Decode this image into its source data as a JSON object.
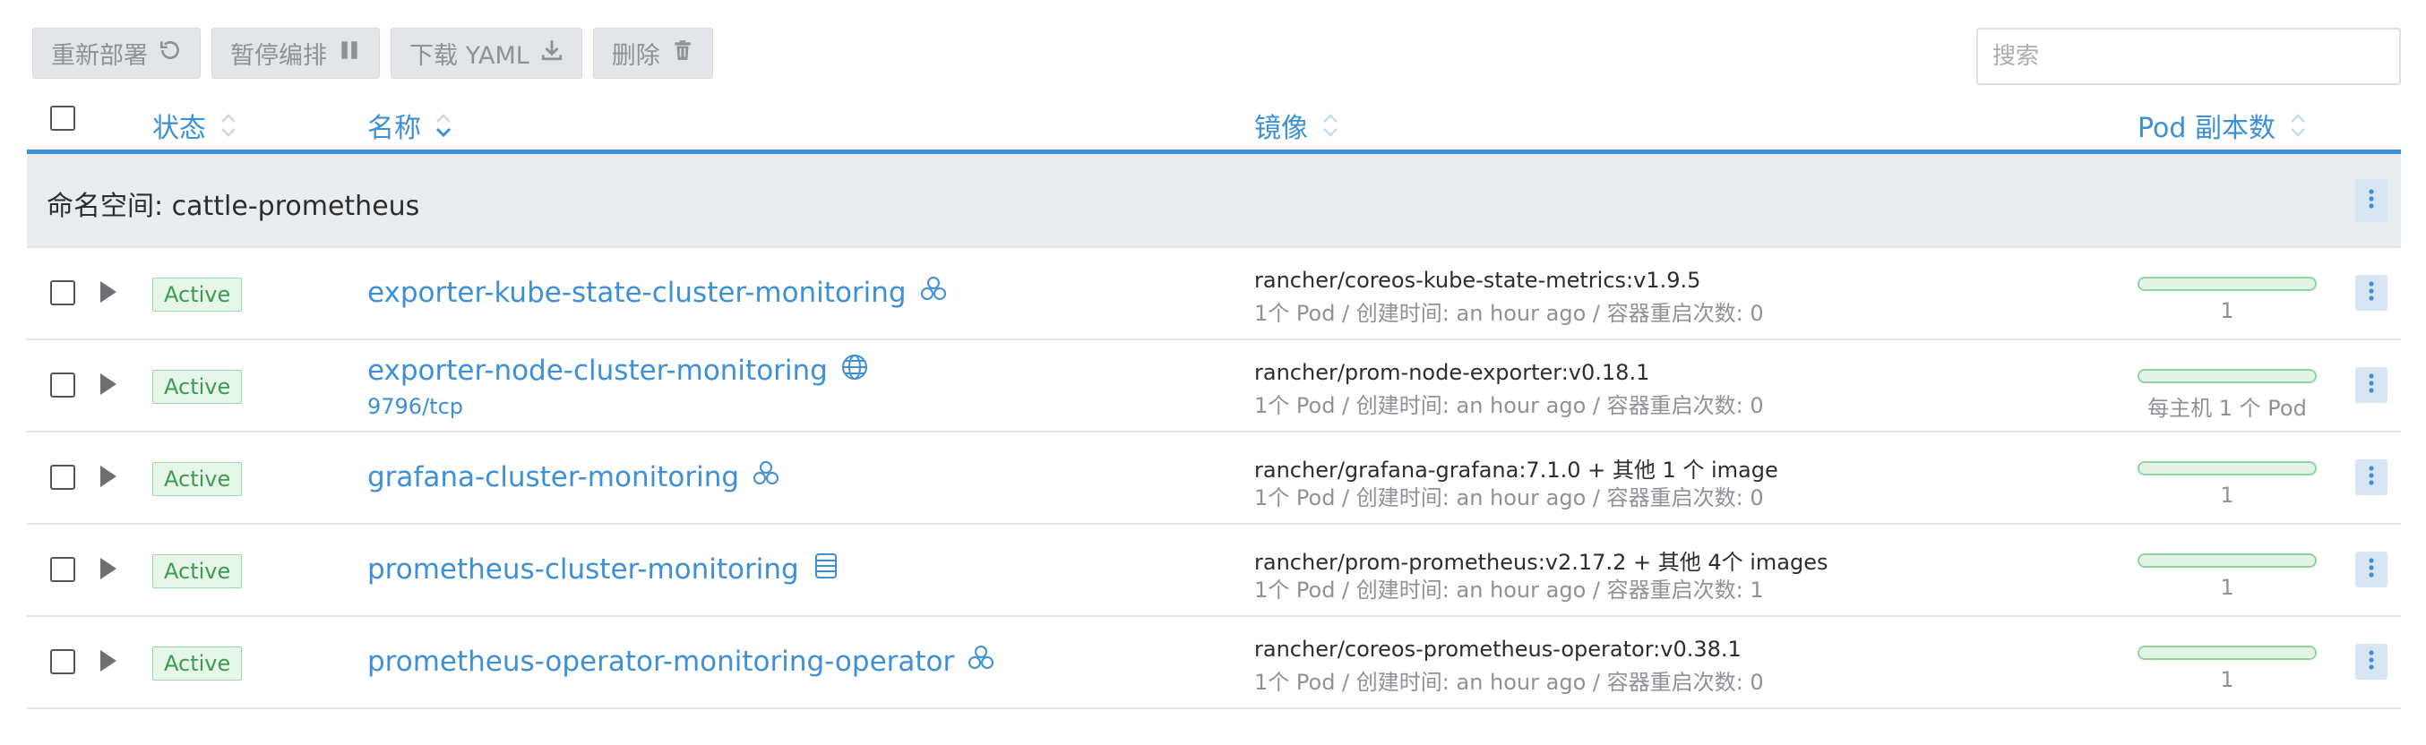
{
  "toolbar": {
    "redeploy_label": "重新部署",
    "pause_label": "暂停编排",
    "download_label": "下载 YAML",
    "delete_label": "删除"
  },
  "search": {
    "placeholder": "搜索",
    "value": ""
  },
  "table": {
    "headers": {
      "state": "状态",
      "name": "名称",
      "image": "镜像",
      "scale": "Pod 副本数"
    },
    "group_title": "命名空间: cattle-prometheus",
    "rows": [
      {
        "state": "Active",
        "name": "exporter-kube-state-cluster-monitoring",
        "icon": "cluster-icon",
        "port": "",
        "image": "rancher/coreos-kube-state-metrics:v1.9.5",
        "detail": "1个 Pod / 创建时间: an hour ago / 容器重启次数: 0",
        "scale": "1",
        "progress": 1.0
      },
      {
        "state": "Active",
        "name": "exporter-node-cluster-monitoring",
        "icon": "globe-icon",
        "port": "9796/tcp",
        "image": "rancher/prom-node-exporter:v0.18.1",
        "detail": "1个 Pod / 创建时间: an hour ago / 容器重启次数: 0",
        "scale": "每主机 1 个 Pod",
        "progress": 1.0
      },
      {
        "state": "Active",
        "name": "grafana-cluster-monitoring",
        "icon": "cluster-icon",
        "port": "",
        "image": "rancher/grafana-grafana:7.1.0 + 其他 1 个 image",
        "detail": "1个 Pod / 创建时间: an hour ago / 容器重启次数: 0",
        "scale": "1",
        "progress": 1.0
      },
      {
        "state": "Active",
        "name": "prometheus-cluster-monitoring",
        "icon": "database-icon",
        "port": "",
        "image": "rancher/prom-prometheus:v2.17.2 + 其他 4个 images",
        "detail": "1个 Pod / 创建时间: an hour ago / 容器重启次数: 1",
        "scale": "1",
        "progress": 1.0
      },
      {
        "state": "Active",
        "name": "prometheus-operator-monitoring-operator",
        "icon": "cluster-icon",
        "port": "",
        "image": "rancher/coreos-prometheus-operator:v0.38.1",
        "detail": "1个 Pod / 创建时间: an hour ago / 容器重启次数: 0",
        "scale": "1",
        "progress": 1.0
      }
    ]
  },
  "colors": {
    "accent": "#3d8fd7",
    "active_bg": "#e6f6e9",
    "active_text": "#3e9a4f"
  }
}
